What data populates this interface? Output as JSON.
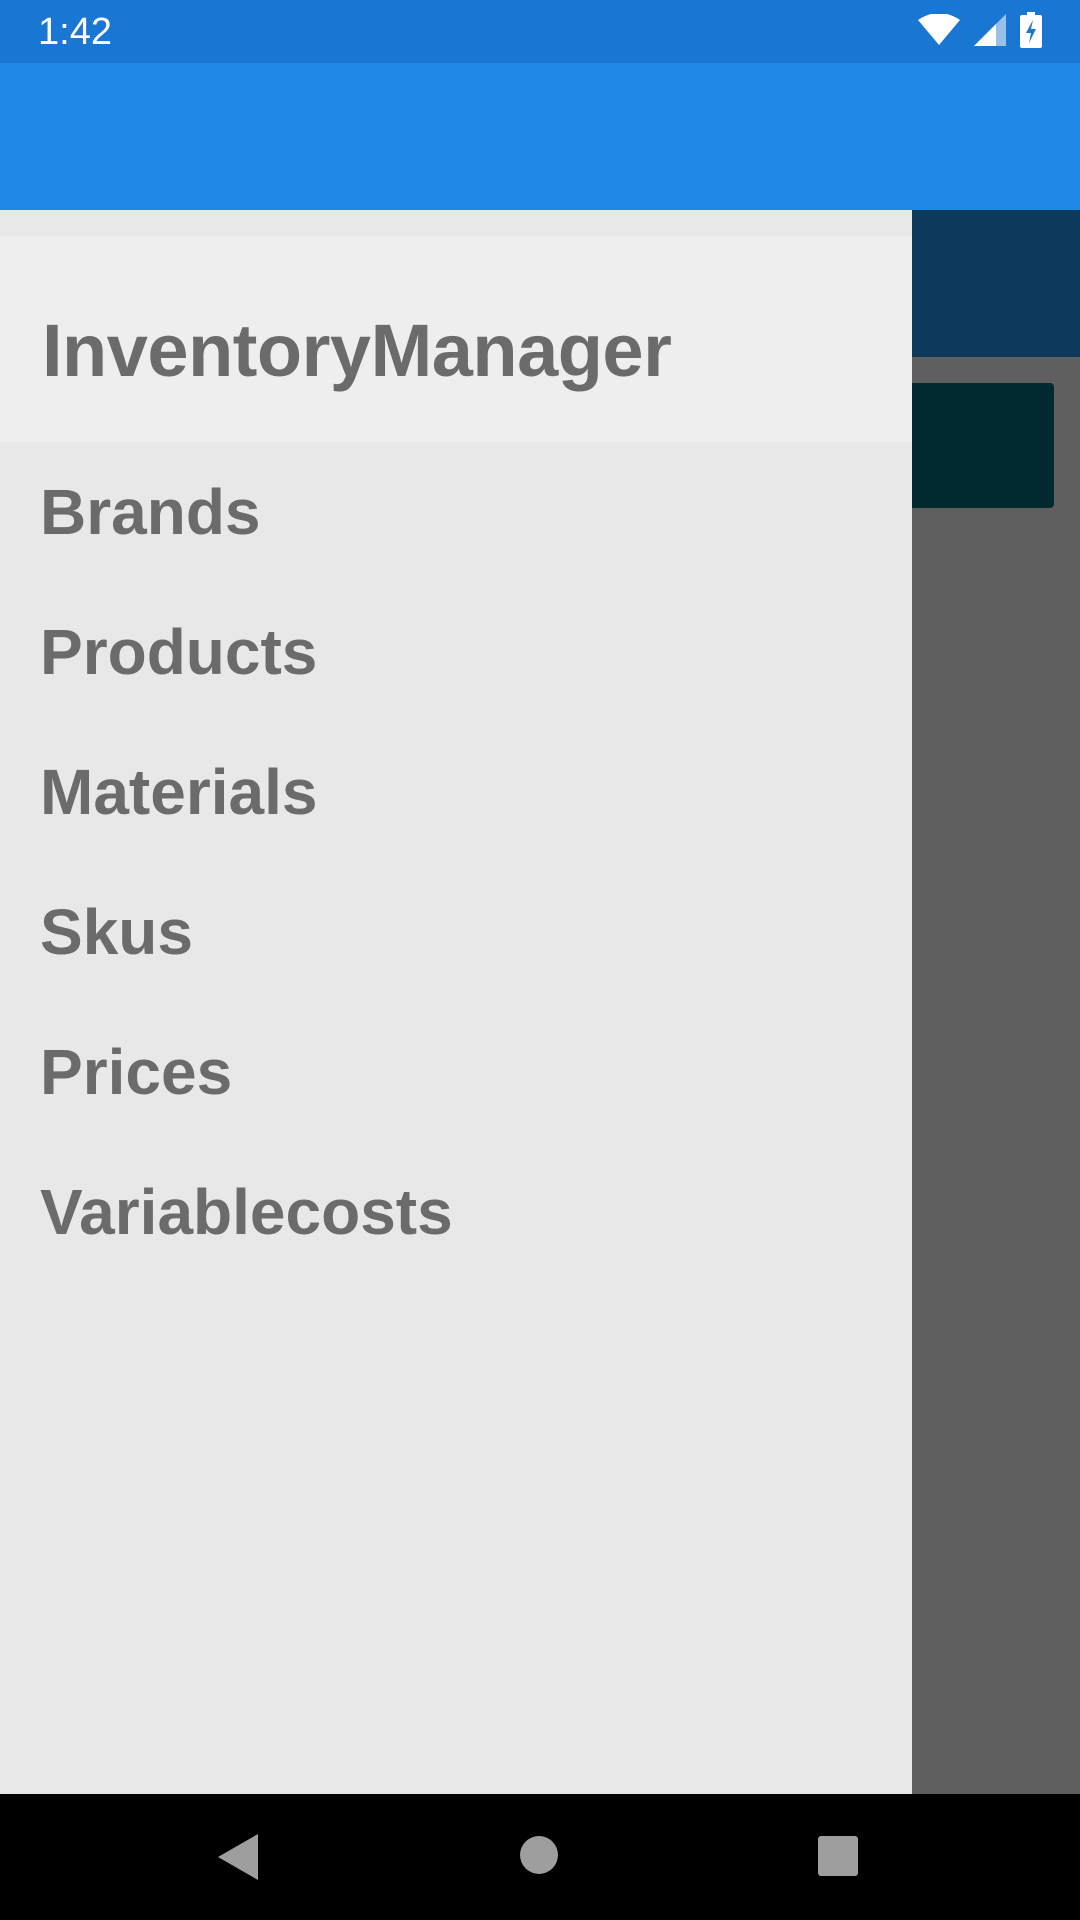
{
  "status_bar": {
    "time": "1:42",
    "icons": [
      "wifi-icon",
      "signal-icon",
      "battery-charging-icon"
    ]
  },
  "app_bar": {
    "color": "#1e88e5"
  },
  "drawer": {
    "title": "InventoryManager",
    "items": [
      {
        "label": "Brands"
      },
      {
        "label": "Products"
      },
      {
        "label": "Materials"
      },
      {
        "label": "Skus"
      },
      {
        "label": "Prices"
      },
      {
        "label": "Variablecosts"
      }
    ]
  },
  "nav_bar": {
    "icons": [
      "back-icon",
      "home-icon",
      "recents-icon"
    ]
  },
  "colors": {
    "status_bar": "#1976d2",
    "app_bar": "#1e88e5",
    "drawer_bg": "#e8e8e8",
    "drawer_header_bg": "#eeeeee",
    "menu_text": "#6b6b6b",
    "scrim": "#5f5f5f"
  }
}
